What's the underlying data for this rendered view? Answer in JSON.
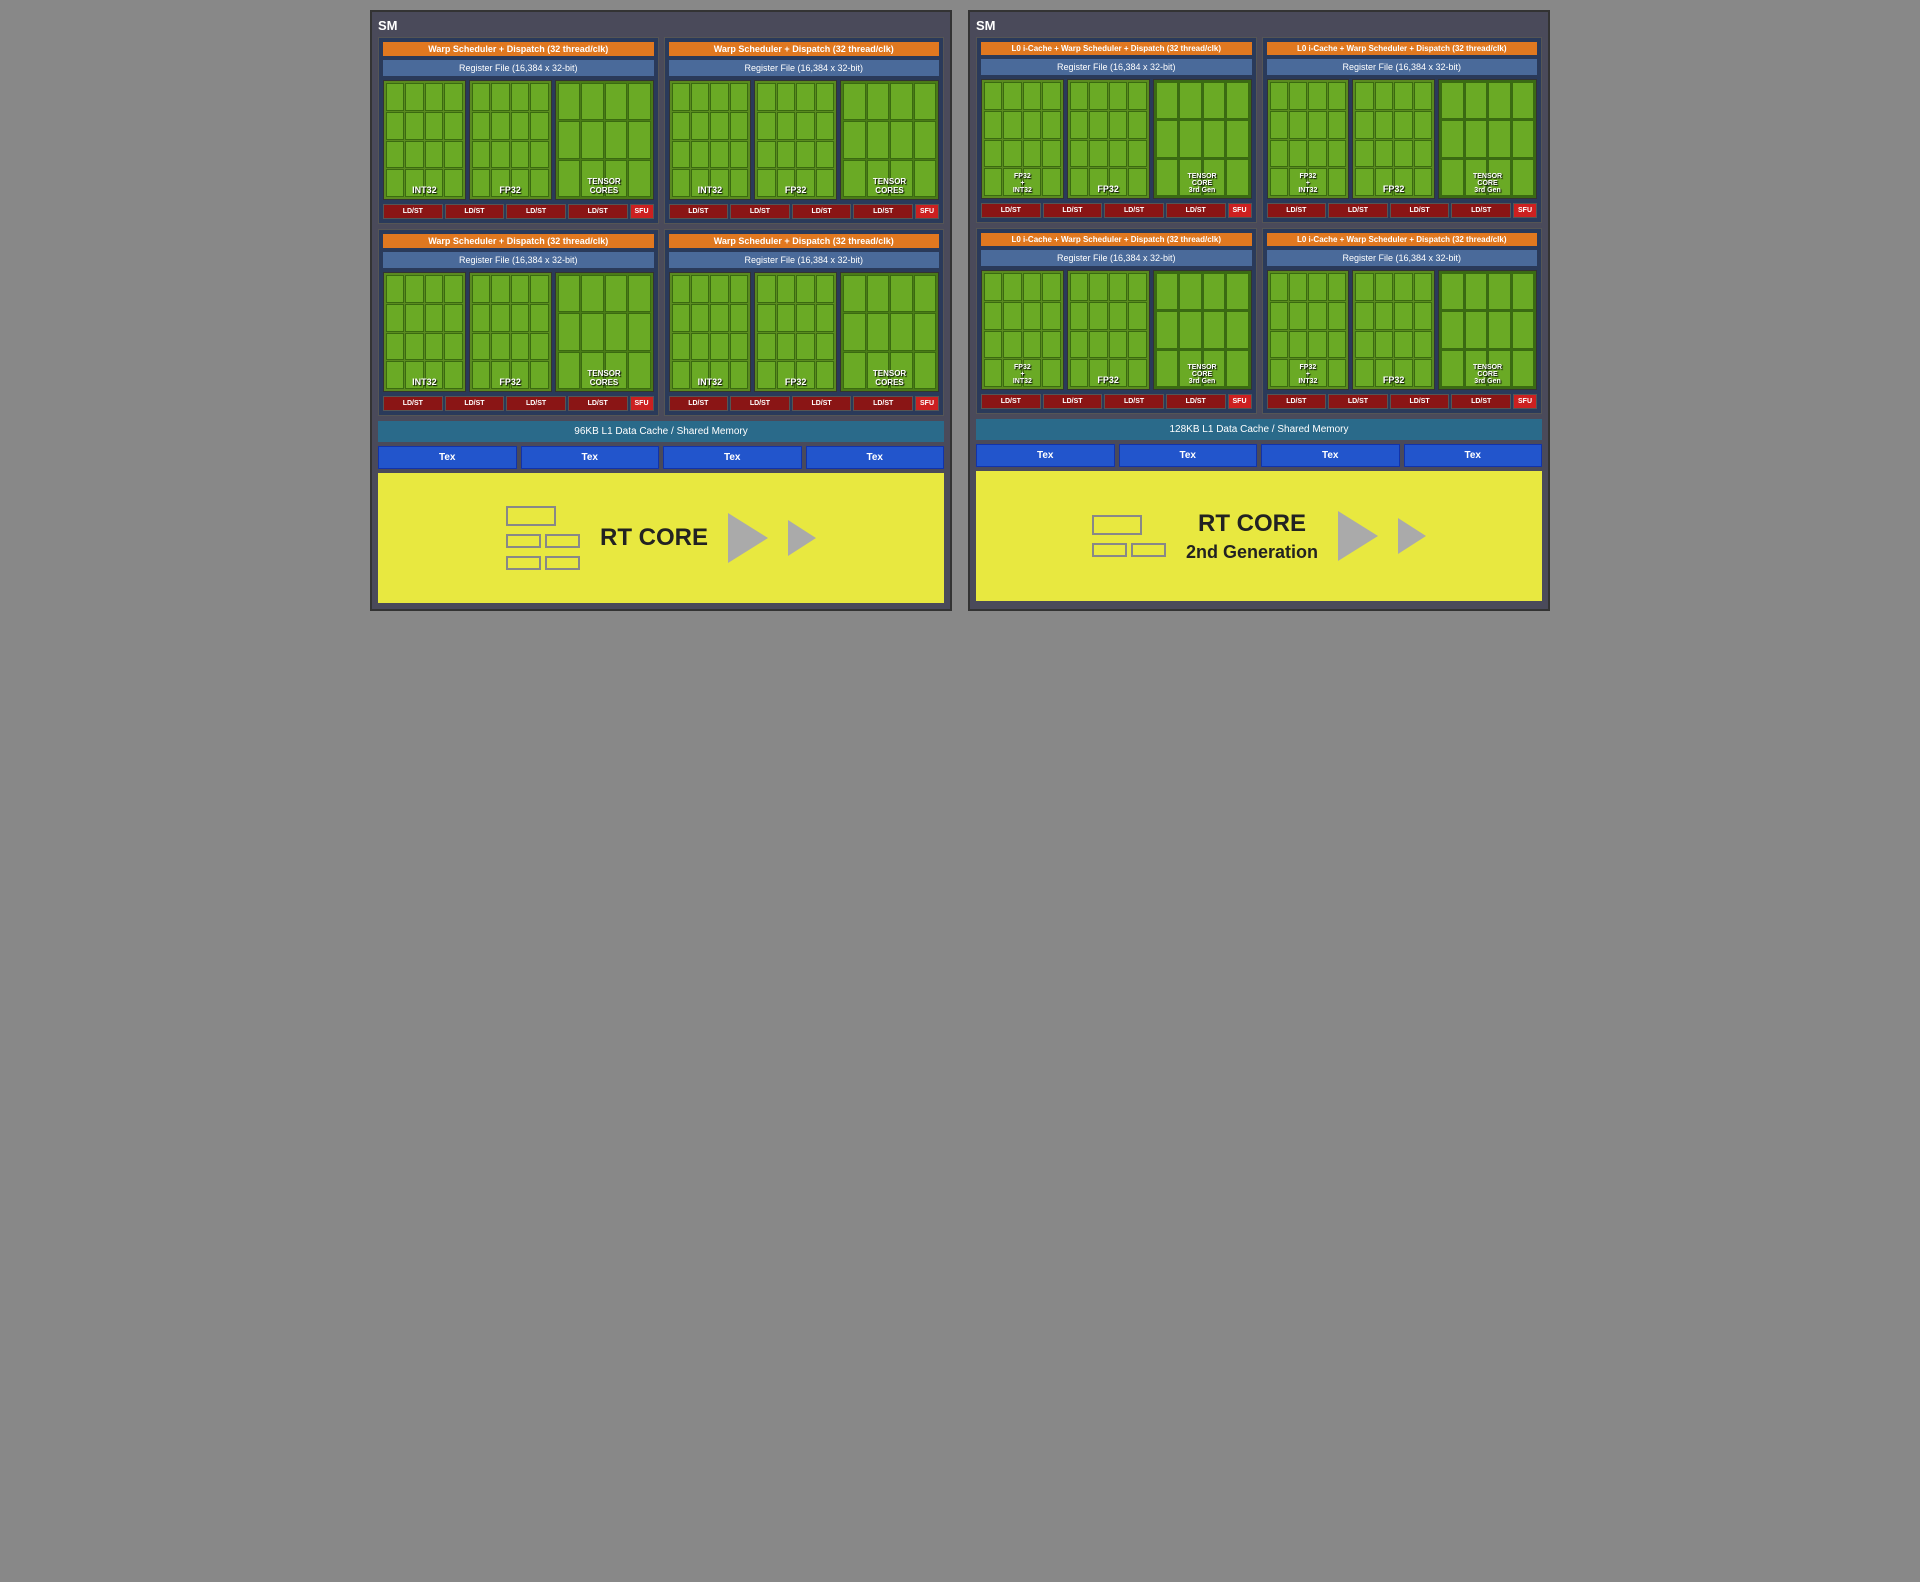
{
  "left_sm": {
    "label": "SM",
    "warp_units": [
      {
        "header": "Warp Scheduler + Dispatch (32 thread/clk)",
        "register_file": "Register File (16,384 x 32-bit)",
        "cores": [
          {
            "label": "INT32",
            "type": "standard"
          },
          {
            "label": "FP32",
            "type": "standard"
          },
          {
            "label": "TENSOR\nCORES",
            "type": "tensor"
          }
        ],
        "ldst": [
          "LD/ST",
          "LD/ST",
          "LD/ST",
          "LD/ST"
        ],
        "sfu": "SFU"
      },
      {
        "header": "Warp Scheduler + Dispatch (32 thread/clk)",
        "register_file": "Register File (16,384 x 32-bit)",
        "cores": [
          {
            "label": "INT32",
            "type": "standard"
          },
          {
            "label": "FP32",
            "type": "standard"
          },
          {
            "label": "TENSOR\nCORES",
            "type": "tensor"
          }
        ],
        "ldst": [
          "LD/ST",
          "LD/ST",
          "LD/ST",
          "LD/ST"
        ],
        "sfu": "SFU"
      },
      {
        "header": "Warp Scheduler + Dispatch (32 thread/clk)",
        "register_file": "Register File (16,384 x 32-bit)",
        "cores": [
          {
            "label": "INT32",
            "type": "standard"
          },
          {
            "label": "FP32",
            "type": "standard"
          },
          {
            "label": "TENSOR\nCORES",
            "type": "tensor"
          }
        ],
        "ldst": [
          "LD/ST",
          "LD/ST",
          "LD/ST",
          "LD/ST"
        ],
        "sfu": "SFU"
      },
      {
        "header": "Warp Scheduler + Dispatch (32 thread/clk)",
        "register_file": "Register File (16,384 x 32-bit)",
        "cores": [
          {
            "label": "INT32",
            "type": "standard"
          },
          {
            "label": "FP32",
            "type": "standard"
          },
          {
            "label": "TENSOR\nCORES",
            "type": "tensor"
          }
        ],
        "ldst": [
          "LD/ST",
          "LD/ST",
          "LD/ST",
          "LD/ST"
        ],
        "sfu": "SFU"
      }
    ],
    "l1_cache": "96KB L1 Data Cache / Shared Memory",
    "tex_units": [
      "Tex",
      "Tex",
      "Tex",
      "Tex"
    ],
    "rt_core": "RT CORE"
  },
  "right_sm": {
    "label": "SM",
    "warp_units": [
      {
        "header": "L0 i-Cache + Warp Scheduler + Dispatch (32 thread/clk)",
        "register_file": "Register File (16,384 x 32-bit)",
        "cores": [
          {
            "label": "FP32\n+\nINT32",
            "type": "standard"
          },
          {
            "label": "FP32",
            "type": "standard"
          },
          {
            "label": "TENSOR\nCORE\n3rd Gen",
            "type": "tensor"
          }
        ],
        "ldst": [
          "LD/ST",
          "LD/ST",
          "LD/ST",
          "LD/ST"
        ],
        "sfu": "SFU"
      },
      {
        "header": "L0 i-Cache + Warp Scheduler + Dispatch (32 thread/clk)",
        "register_file": "Register File (16,384 x 32-bit)",
        "cores": [
          {
            "label": "FP32\n+\nINT32",
            "type": "standard"
          },
          {
            "label": "FP32",
            "type": "standard"
          },
          {
            "label": "TENSOR\nCORE\n3rd Gen",
            "type": "tensor"
          }
        ],
        "ldst": [
          "LD/ST",
          "LD/ST",
          "LD/ST",
          "LD/ST"
        ],
        "sfu": "SFU"
      },
      {
        "header": "L0 i-Cache + Warp Scheduler + Dispatch (32 thread/clk)",
        "register_file": "Register File (16,384 x 32-bit)",
        "cores": [
          {
            "label": "FP32\n+\nINT32",
            "type": "standard"
          },
          {
            "label": "FP32",
            "type": "standard"
          },
          {
            "label": "TENSOR\nCORE\n3rd Gen",
            "type": "tensor"
          }
        ],
        "ldst": [
          "LD/ST",
          "LD/ST",
          "LD/ST",
          "LD/ST"
        ],
        "sfu": "SFU"
      },
      {
        "header": "L0 i-Cache + Warp Scheduler + Dispatch (32 thread/clk)",
        "register_file": "Register File (16,384 x 32-bit)",
        "cores": [
          {
            "label": "FP32\n+\nINT32",
            "type": "standard"
          },
          {
            "label": "FP32",
            "type": "standard"
          },
          {
            "label": "TENSOR\nCORE\n3rd Gen",
            "type": "tensor"
          }
        ],
        "ldst": [
          "LD/ST",
          "LD/ST",
          "LD/ST",
          "LD/ST"
        ],
        "sfu": "SFU"
      }
    ],
    "l1_cache": "128KB L1 Data Cache / Shared Memory",
    "tex_units": [
      "Tex",
      "Tex",
      "Tex",
      "Tex"
    ],
    "rt_core": "RT CORE",
    "rt_core_gen": "2nd Generation"
  }
}
